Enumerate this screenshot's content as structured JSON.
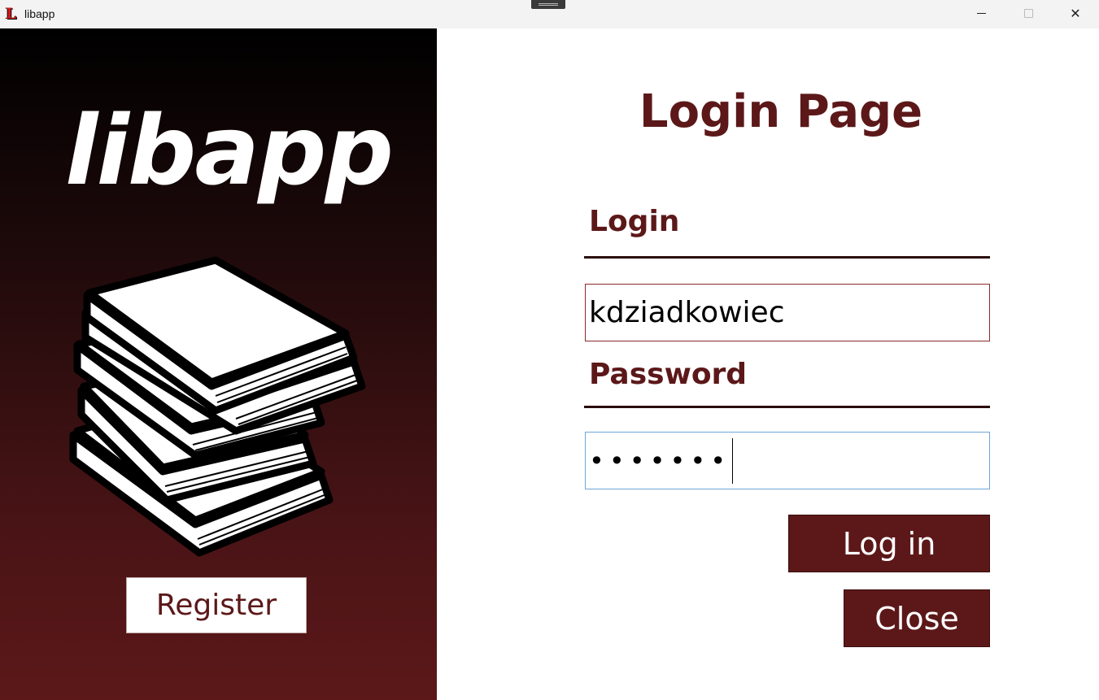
{
  "window": {
    "title": "libapp",
    "app_icon_letter": "L",
    "app_icon": "libapp-logo-icon",
    "controls": [
      "minimize-icon",
      "maximize-icon",
      "close-icon"
    ],
    "close_glyph": "✕"
  },
  "colors": {
    "accent": "#5c1819",
    "panel_top": "#000000",
    "panel_bottom": "#5c1819",
    "focus_border": "#6ea6d8"
  },
  "sidebar": {
    "brand": "libapp",
    "illustration": "book-stack-icon",
    "register_label": "Register"
  },
  "form": {
    "title": "Login Page",
    "login_label": "Login",
    "login_value": "kdziadkowiec",
    "password_label": "Password",
    "password_masked": "•••••••",
    "login_button": "Log in",
    "close_button": "Close"
  }
}
